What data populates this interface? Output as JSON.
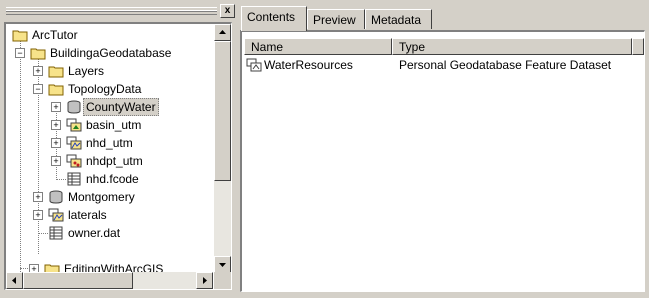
{
  "catalog_tree": {
    "close_label": "x",
    "items": [
      {
        "label": "ArcTutor",
        "icon": "folder-icon",
        "expander": ""
      },
      {
        "label": "BuildingaGeodatabase",
        "icon": "folder-icon",
        "expander": "−"
      },
      {
        "label": "Layers",
        "icon": "folder-icon",
        "expander": "+"
      },
      {
        "label": "TopologyData",
        "icon": "folder-icon",
        "expander": "−"
      },
      {
        "label": "CountyWater",
        "icon": "personal-geodatabase-icon",
        "expander": "+"
      },
      {
        "label": "basin_utm",
        "icon": "coverage-icon",
        "expander": "+"
      },
      {
        "label": "nhd_utm",
        "icon": "coverage-icon",
        "expander": "+"
      },
      {
        "label": "nhdpt_utm",
        "icon": "coverage-icon",
        "expander": "+"
      },
      {
        "label": "nhd.fcode",
        "icon": "table-icon",
        "expander": ""
      },
      {
        "label": "Montgomery",
        "icon": "personal-geodatabase-icon",
        "expander": "+"
      },
      {
        "label": "laterals",
        "icon": "coverage-icon",
        "expander": "+"
      },
      {
        "label": "owner.dat",
        "icon": "table-icon",
        "expander": ""
      },
      {
        "label": "EditingWithArcGIS",
        "icon": "folder-icon",
        "expander": "+"
      }
    ],
    "selected": "CountyWater"
  },
  "tabs": [
    {
      "label": "Contents",
      "active": true
    },
    {
      "label": "Preview",
      "active": false
    },
    {
      "label": "Metadata",
      "active": false
    }
  ],
  "contents": {
    "columns": [
      "Name",
      "Type"
    ],
    "rows": [
      {
        "name": "WaterResources",
        "type": "Personal Geodatabase Feature Dataset",
        "icon": "feature-dataset-icon"
      }
    ]
  }
}
